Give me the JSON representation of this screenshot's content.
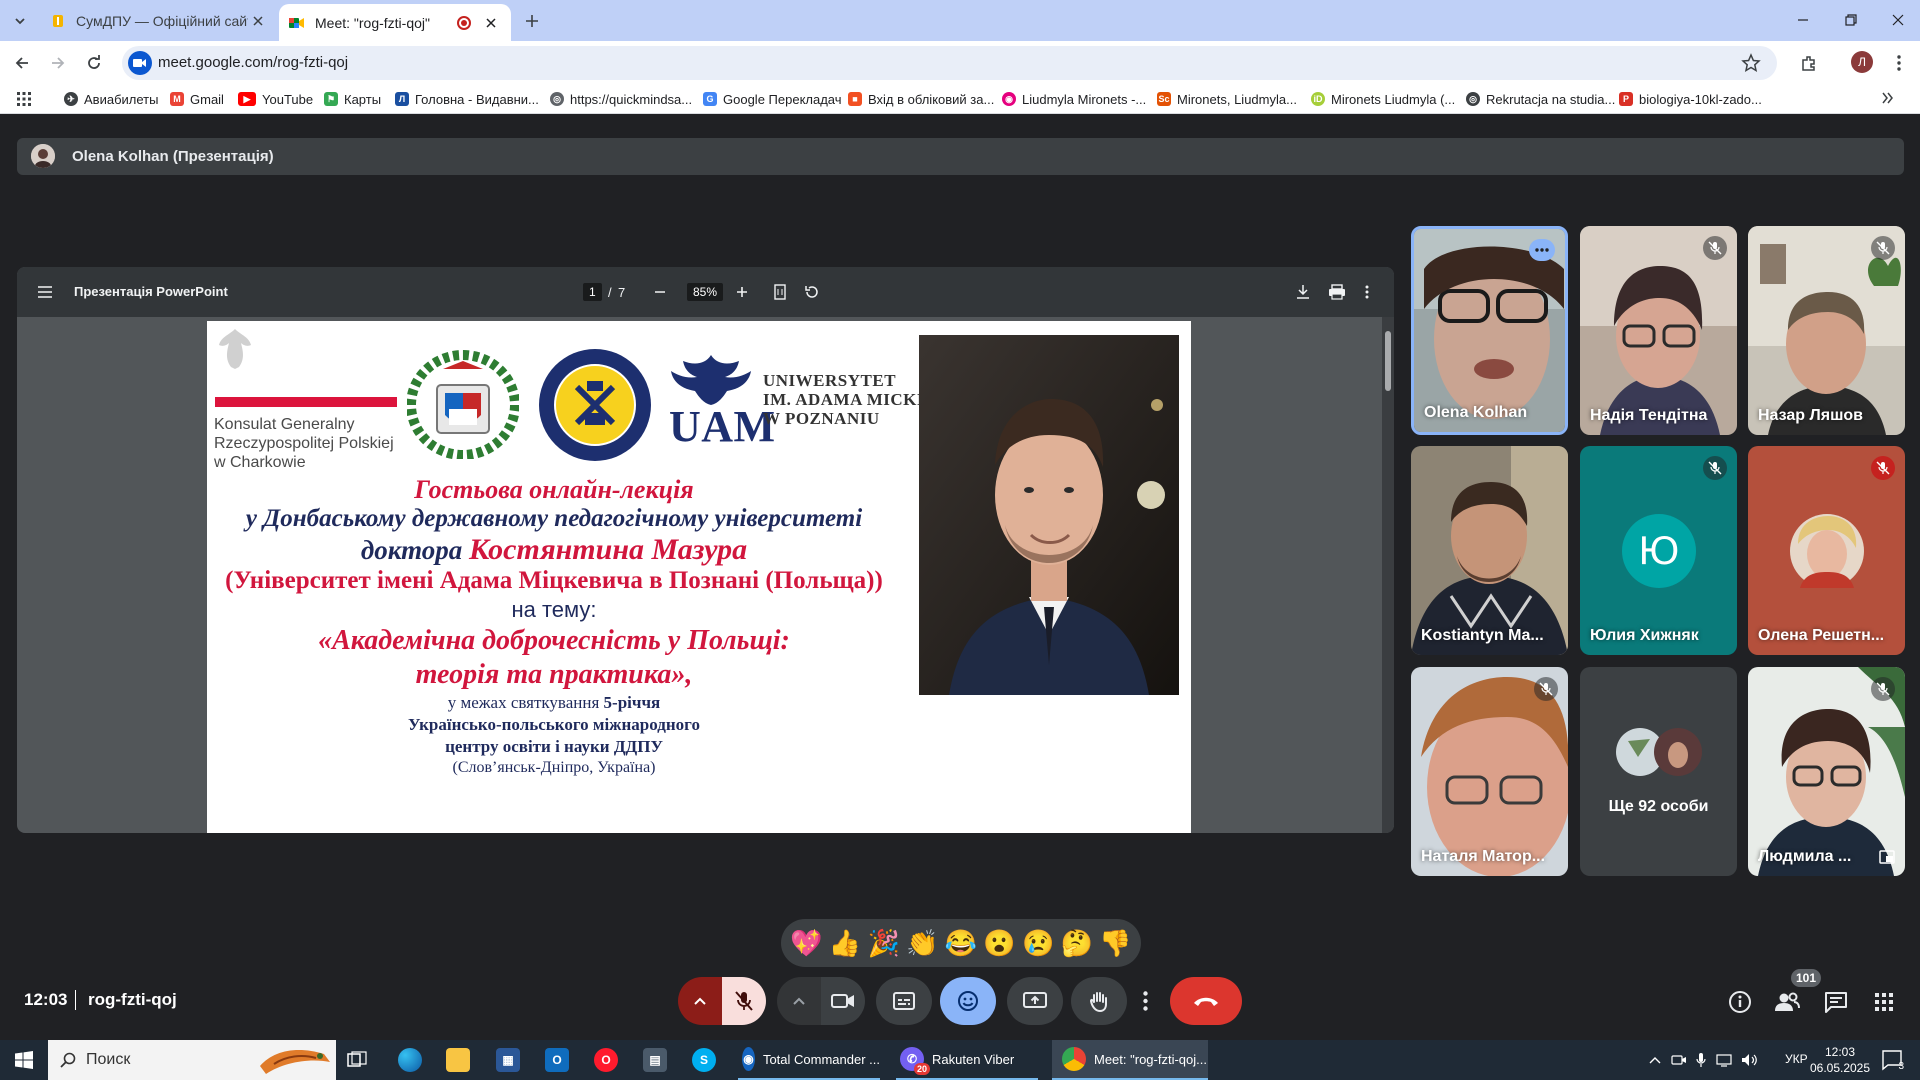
{
  "browser": {
    "tabs": [
      {
        "title": "СумДПУ — Офіційний сайт С..."
      },
      {
        "title": "Meet: \"rog-fzti-qoj\""
      }
    ],
    "url": "meet.google.com/rog-fzti-qoj",
    "profile_initial": "Л",
    "bookmarks": [
      "Авиабилеты",
      "Gmail",
      "YouTube",
      "Карты",
      "Головна - Видавни...",
      "https://quickmindsa...",
      "Google Перекладач",
      "Вхід в обліковий за...",
      "Liudmyla Mironets -...",
      "Mironets, Liudmyla...",
      "Mironets Liudmyla (...",
      "Rekrutacja na studia...",
      "biologiya-10kl-zado..."
    ]
  },
  "meet": {
    "presenter_label": "Olena Kolhan (Презентація)",
    "viewer": {
      "title": "Презентація PowerPoint",
      "page_current": "1",
      "page_sep": "/",
      "page_total": "7",
      "zoom": "85%"
    },
    "slide": {
      "consulate": [
        "Konsulat Generalny",
        "Rzeczypospolitej Polskiej",
        "w Charkowie"
      ],
      "university": [
        "UNIWERSYTET",
        "IM. ADAMA MICKIEWICZA",
        "W POZNANIU"
      ],
      "uam": "UAM",
      "line1": "Гостьова онлайн-лекція",
      "line2": "у Донбаському державному педагогічному університеті",
      "line3a": "доктора ",
      "line3b": "Костянтина Мазура",
      "line4": "(Університет імені Адама Міцкевича в Познані (Польща))",
      "line5": "на тему:",
      "line6": "«Академічна доброчесність у Польщі:",
      "line7": "теорія та практика»,",
      "line8a": "у межах святкування ",
      "line8b": "5-річчя",
      "line9": "Українсько-польського міжнародного",
      "line10": "центру освіти і науки ДДПУ",
      "line11": "(Слов’янськ-Дніпро, Україна)"
    },
    "participants": [
      {
        "name": "Olena Kolhan"
      },
      {
        "name": "Надія Тендітна"
      },
      {
        "name": "Назар Ляшов"
      },
      {
        "name": "Kostiantyn Ma..."
      },
      {
        "name": "Юлия Хижняк",
        "initial": "Ю"
      },
      {
        "name": "Олена Решетн..."
      },
      {
        "name": "Наталя Матор..."
      },
      {
        "name": "Ще 92 особи"
      },
      {
        "name": "Людмила ..."
      }
    ],
    "reactions": [
      "💖",
      "👍",
      "🎉",
      "👏",
      "😂",
      "😮",
      "😢",
      "🤔",
      "👎"
    ],
    "time": "12:03",
    "meeting_code": "rog-fzti-qoj",
    "people_count": "101"
  },
  "taskbar": {
    "search_placeholder": "Поиск",
    "apps": [
      {
        "label": "Total Commander ..."
      },
      {
        "label": "Rakuten Viber",
        "badge": "20"
      },
      {
        "label": "Meet: \"rog-fzti-qoj..."
      }
    ],
    "lang": "УКР",
    "time": "12:03",
    "date": "06.05.2025",
    "notifications": "3"
  },
  "colors": {
    "accent_blue": "#8ab4f8",
    "hangup_red": "#dc362e",
    "meet_bg": "#202124"
  }
}
